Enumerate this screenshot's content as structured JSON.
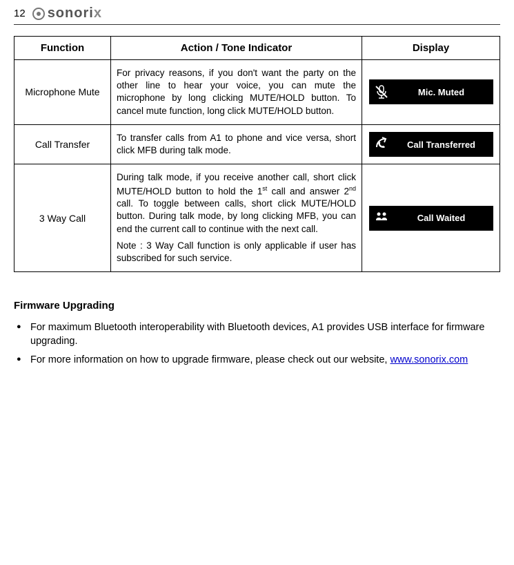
{
  "page_number": "12",
  "brand": "sonorix",
  "table": {
    "headers": [
      "Function",
      "Action / Tone Indicator",
      "Display"
    ],
    "rows": [
      {
        "function": "Microphone Mute",
        "action": "For privacy reasons, if you don't want the party on the other line to hear your voice, you can mute the microphone by long clicking MUTE/HOLD button. To cancel mute function, long click MUTE/HOLD button.",
        "note": "",
        "display_label": "Mic. Muted",
        "icon": "mic-muted"
      },
      {
        "function": "Call Transfer",
        "action": "To transfer calls from A1 to phone and vice versa, short click MFB during talk mode.",
        "note": "",
        "display_label": "Call Transferred",
        "icon": "transfer"
      },
      {
        "function": "3 Way Call",
        "action_html": "During talk mode, if you receive another call, short click MUTE/HOLD button to hold the 1<sup>st</sup> call and answer 2<sup>nd</sup> call. To toggle between calls, short click MUTE/HOLD button. During talk mode, by long clicking MFB, you can end the current call to continue with the next call.",
        "note": "Note : 3 Way Call function is only applicable if user has subscribed for such service.",
        "display_label": "Call Waited",
        "icon": "waited"
      }
    ]
  },
  "firmware": {
    "heading": "Firmware Upgrading",
    "bullet1": "For maximum Bluetooth interoperability with Bluetooth devices, A1 provides USB interface for firmware upgrading.",
    "bullet2_prefix": "For more information on how to upgrade firmware, please check out our website, ",
    "bullet2_link": "www.sonorix.com"
  }
}
